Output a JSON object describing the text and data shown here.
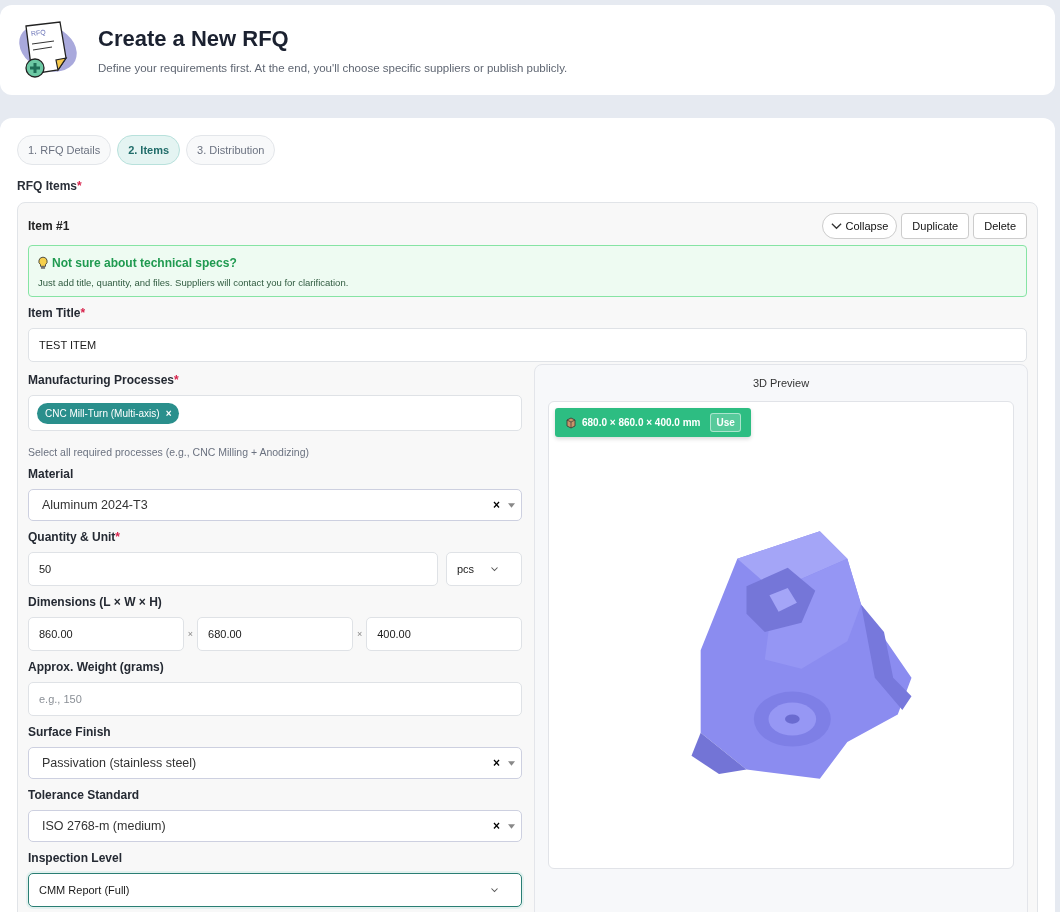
{
  "header": {
    "logo_label": "RFQ",
    "title": "Create a New RFQ",
    "subtitle": "Define your requirements first. At the end, you'll choose specific suppliers or publish publicly."
  },
  "tabs": [
    {
      "label": "1. RFQ Details",
      "selected": false
    },
    {
      "label": "2. Items",
      "selected": true
    },
    {
      "label": "3. Distribution",
      "selected": false
    }
  ],
  "section": {
    "label": "RFQ Items",
    "required_mark": "*"
  },
  "item": {
    "title": "Item #1",
    "collapse": "Collapse",
    "buttons": [
      "Duplicate",
      "Delete"
    ],
    "tip": {
      "title": "Not sure about technical specs?",
      "text": "Just add title, quantity, and files. Suppliers will contact you for clarification."
    },
    "title_field": {
      "label": "Item Title",
      "required_mark": "*",
      "value": "TEST ITEM"
    },
    "fields": [
      {
        "kind": "chips",
        "label": "Manufacturing Processes",
        "required_mark": "*",
        "chips": [
          "CNC Mill-Turn (Multi-axis)"
        ],
        "remove": "×",
        "help": "Select all required processes (e.g., CNC Milling + Anodizing)"
      },
      {
        "kind": "select",
        "label": "Material",
        "value": "Aluminum 2024-T3",
        "clear": "×"
      },
      {
        "kind": "quantity",
        "label": "Quantity & Unit",
        "required_mark": "*",
        "value": "50",
        "unit": "pcs"
      },
      {
        "kind": "dimensions",
        "label": "Dimensions (L × W × H)",
        "values": [
          "860.00",
          "680.00",
          "400.00"
        ],
        "separator": "×"
      },
      {
        "kind": "text",
        "label": "Approx. Weight (grams)",
        "placeholder": "e.g., 150"
      },
      {
        "kind": "select",
        "label": "Surface Finish",
        "value": "Passivation (stainless steel)",
        "clear": "×"
      },
      {
        "kind": "select",
        "label": "Tolerance Standard",
        "value": "ISO 2768-m (medium)",
        "clear": "×"
      },
      {
        "kind": "dropdown",
        "label": "Inspection Level",
        "value": "CMM Report (Full)",
        "focused": true
      }
    ],
    "preview": {
      "title": "3D Preview",
      "badge": "680.0 × 860.0 × 400.0 mm",
      "use": "Use"
    }
  }
}
